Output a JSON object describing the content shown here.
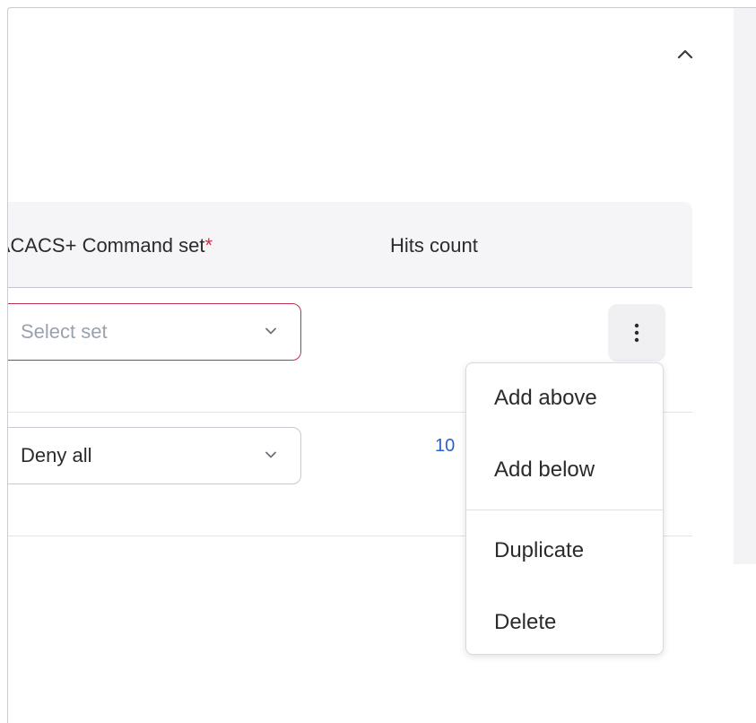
{
  "table": {
    "columns": {
      "command_set": "TACACS+ Command set",
      "required_mark": "*",
      "hits_count": "Hits count"
    },
    "rows": [
      {
        "select_placeholder": "Select set",
        "hits": ""
      },
      {
        "select_value": "Deny all",
        "hits": "10"
      }
    ]
  },
  "context_menu": {
    "items": [
      "Add above",
      "Add below",
      "Duplicate",
      "Delete"
    ]
  },
  "colors": {
    "error_border": "#b8344a",
    "required_mark": "#c0364b",
    "link_blue": "#2a62c9",
    "header_bg": "#f5f5f7"
  },
  "icons": {
    "collapse": "chevron-up-icon",
    "select_caret": "chevron-down-icon",
    "more": "more-vertical-icon"
  }
}
